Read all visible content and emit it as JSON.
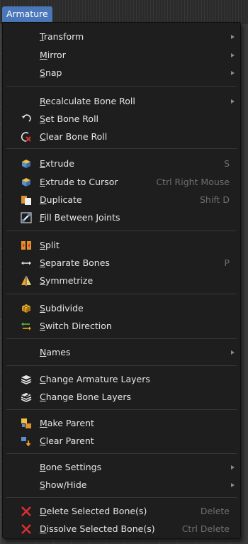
{
  "menu": {
    "title": "Armature",
    "items": [
      {
        "label": "Transform",
        "shortcut": "",
        "submenu": true,
        "icon": ""
      },
      {
        "label": "Mirror",
        "shortcut": "",
        "submenu": true,
        "icon": ""
      },
      {
        "label": "Snap",
        "shortcut": "",
        "submenu": true,
        "icon": ""
      },
      {
        "label": "Recalculate Bone Roll",
        "shortcut": "",
        "submenu": true,
        "icon": ""
      },
      {
        "label": "Set Bone Roll",
        "shortcut": "",
        "submenu": false,
        "icon": "rotate-arrow-icon"
      },
      {
        "label": "Clear Bone Roll",
        "shortcut": "",
        "submenu": false,
        "icon": "clear-roll-icon"
      },
      {
        "label": "Extrude",
        "shortcut": "S",
        "submenu": false,
        "icon": "extrude-icon"
      },
      {
        "label": "Extrude to Cursor",
        "shortcut": "Ctrl Right Mouse",
        "submenu": false,
        "icon": "extrude-cursor-icon"
      },
      {
        "label": "Duplicate",
        "shortcut": "Shift D",
        "submenu": false,
        "icon": "duplicate-icon"
      },
      {
        "label": "Fill Between Joints",
        "shortcut": "",
        "submenu": false,
        "icon": "fill-joints-icon"
      },
      {
        "label": "Split",
        "shortcut": "",
        "submenu": false,
        "icon": "split-icon"
      },
      {
        "label": "Separate Bones",
        "shortcut": "P",
        "submenu": false,
        "icon": "separate-icon"
      },
      {
        "label": "Symmetrize",
        "shortcut": "",
        "submenu": false,
        "icon": "symmetrize-icon"
      },
      {
        "label": "Subdivide",
        "shortcut": "",
        "submenu": false,
        "icon": "subdivide-icon"
      },
      {
        "label": "Switch Direction",
        "shortcut": "",
        "submenu": false,
        "icon": "switch-direction-icon"
      },
      {
        "label": "Names",
        "shortcut": "",
        "submenu": true,
        "icon": ""
      },
      {
        "label": "Change Armature Layers",
        "shortcut": "",
        "submenu": false,
        "icon": "layers-icon"
      },
      {
        "label": "Change Bone Layers",
        "shortcut": "",
        "submenu": false,
        "icon": "bone-layers-icon"
      },
      {
        "label": "Make Parent",
        "shortcut": "",
        "submenu": false,
        "icon": "make-parent-icon"
      },
      {
        "label": "Clear Parent",
        "shortcut": "",
        "submenu": false,
        "icon": "clear-parent-icon"
      },
      {
        "label": "Bone Settings",
        "shortcut": "",
        "submenu": true,
        "icon": ""
      },
      {
        "label": "Show/Hide",
        "shortcut": "",
        "submenu": true,
        "icon": ""
      },
      {
        "label": "Delete Selected Bone(s)",
        "shortcut": "Delete",
        "submenu": false,
        "icon": "delete-x-icon"
      },
      {
        "label": "Dissolve Selected Bone(s)",
        "shortcut": "Ctrl Delete",
        "submenu": false,
        "icon": "dissolve-x-icon"
      }
    ]
  },
  "colors": {
    "menu_bg": "#1e1e1e",
    "title_bg": "#4a77b8",
    "text": "#e6e6e6",
    "shortcut": "#6f6f6f"
  }
}
